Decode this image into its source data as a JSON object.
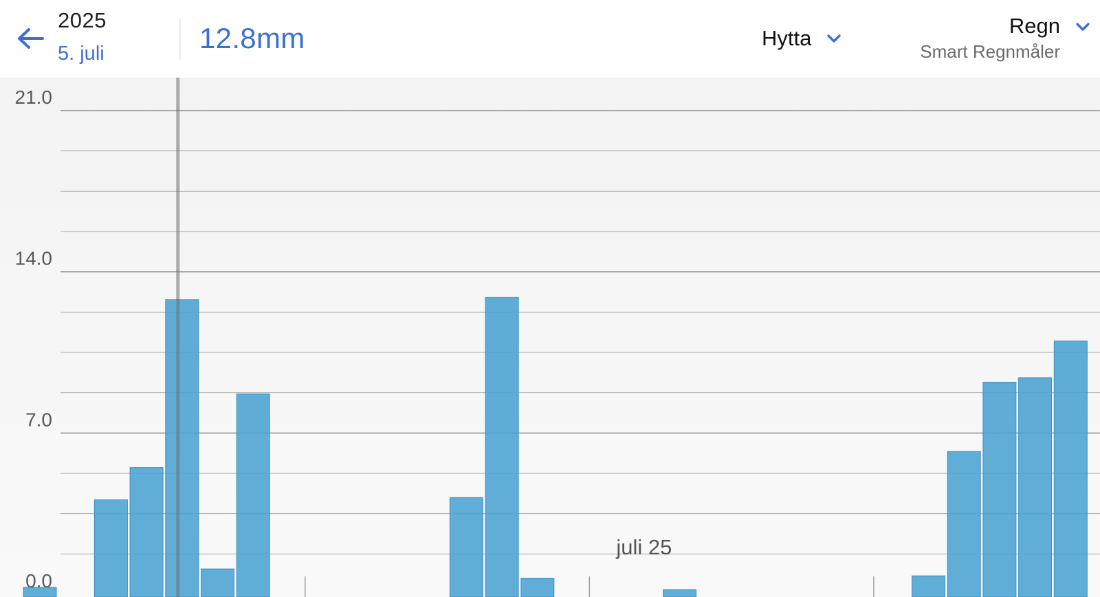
{
  "header": {
    "year": "2025",
    "date": "5. juli",
    "value": "12.8mm",
    "location": "Hytta",
    "sensor_name": "Regn",
    "sensor_model": "Smart Regnmåler"
  },
  "icons": {
    "back": "arrow-left-icon",
    "dropdown": "chevron-down-icon"
  },
  "colors": {
    "accent": "#3b6fd8",
    "bar": "#4aa3d3",
    "bar_stroke": "#3b8fbf",
    "selection_line": "#6e6e6e"
  },
  "chart_data": {
    "type": "bar",
    "unit": "mm",
    "title": "",
    "xlabel": "",
    "ylabel": "",
    "ylim": [
      0,
      21
    ],
    "y_ticks": [
      "0.0",
      "7.0",
      "14.0",
      "21.0"
    ],
    "grid": true,
    "x_start": "2025-07-01",
    "x_labels": [
      {
        "text": "juli 25",
        "at": "2025-07-18"
      }
    ],
    "x_minor_ticks": [
      "2025-07-09",
      "2025-07-17",
      "2025-07-25"
    ],
    "selected": "2025-07-05",
    "series": [
      {
        "values": [
          0.3,
          null,
          4.1,
          5.5,
          12.8,
          1.1,
          8.7,
          null,
          null,
          null,
          null,
          null,
          4.2,
          12.9,
          0.7,
          null,
          null,
          null,
          0.2,
          null,
          null,
          null,
          null,
          null,
          null,
          0.8,
          6.2,
          9.2,
          9.4,
          11.0
        ]
      }
    ]
  }
}
